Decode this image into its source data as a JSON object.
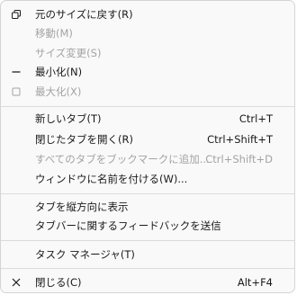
{
  "menu": {
    "items": [
      {
        "label": "元のサイズに戻す(R)",
        "icon": "restore-icon",
        "disabled": false
      },
      {
        "label": "移動(M)",
        "disabled": true
      },
      {
        "label": "サイズ変更(S)",
        "disabled": true
      },
      {
        "label": "最小化(N)",
        "icon": "minimize-icon",
        "disabled": false
      },
      {
        "label": "最大化(X)",
        "icon": "maximize-icon",
        "disabled": true
      },
      {
        "label": "新しいタブ(T)",
        "shortcut": "Ctrl+T",
        "disabled": false
      },
      {
        "label": "閉じたタブを開く(R)",
        "shortcut": "Ctrl+Shift+T",
        "disabled": false
      },
      {
        "label": "すべてのタブをブックマークに追加...",
        "shortcut": "Ctrl+Shift+D",
        "disabled": true
      },
      {
        "label": "ウィンドウに名前を付ける(W)...",
        "disabled": false
      },
      {
        "label": "タブを縦方向に表示",
        "disabled": false
      },
      {
        "label": "タブバーに関するフィードバックを送信",
        "disabled": false
      },
      {
        "label": "タスク マネージャ(T)",
        "disabled": false
      },
      {
        "label": "閉じる(C)",
        "shortcut": "Alt+F4",
        "icon": "close-icon",
        "disabled": false
      }
    ]
  },
  "colors": {
    "text": "#1a1a1a",
    "disabled_text": "#a3a3a3",
    "background": "#f9f9f9",
    "separator": "#dcdcdc"
  }
}
